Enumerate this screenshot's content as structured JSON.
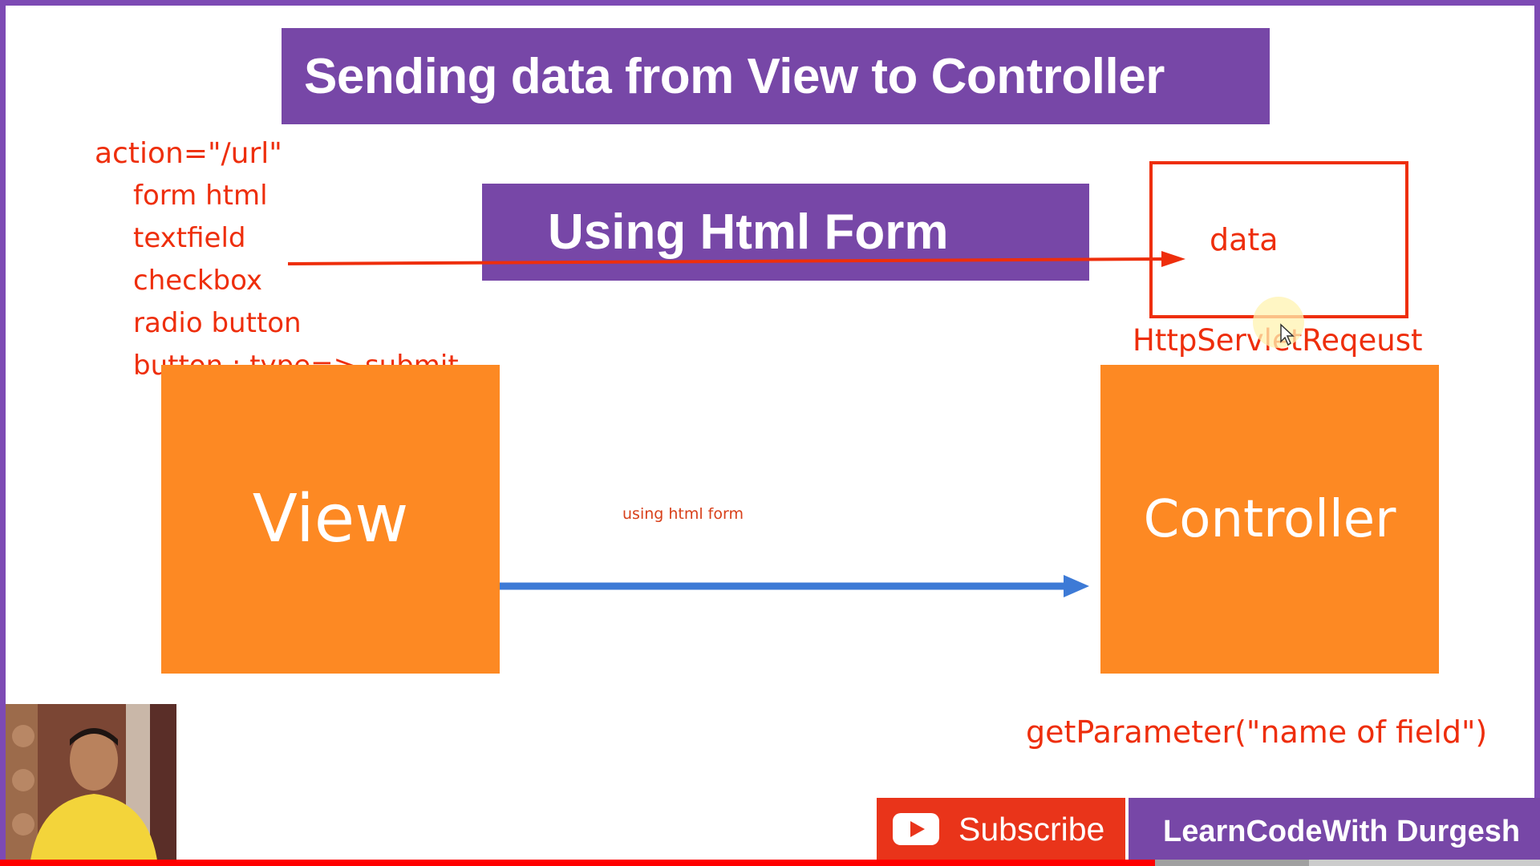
{
  "slide": {
    "title": "Sending data from View to Controller",
    "subtitle": "Using Html Form",
    "action_line": "action=\"/url\"",
    "form_items": [
      "form html",
      "textfield",
      "checkbox",
      "radio button",
      "button : type=> submit"
    ],
    "view_label": "View",
    "controller_label": "Controller",
    "data_label": "data",
    "request_label": "HttpServletReqeust",
    "arrow_hint": "using html form",
    "param_label": "getParameter(\"name of field\")"
  },
  "overlay": {
    "subscribe_label": "Subscribe",
    "channel_name": "LearnCodeWith Durgesh"
  },
  "video": {
    "progress": 0.75
  },
  "colors": {
    "purple": "#7747a7",
    "orange": "#fd8923",
    "red": "#ee2e0c",
    "blue": "#3d7ad6"
  }
}
